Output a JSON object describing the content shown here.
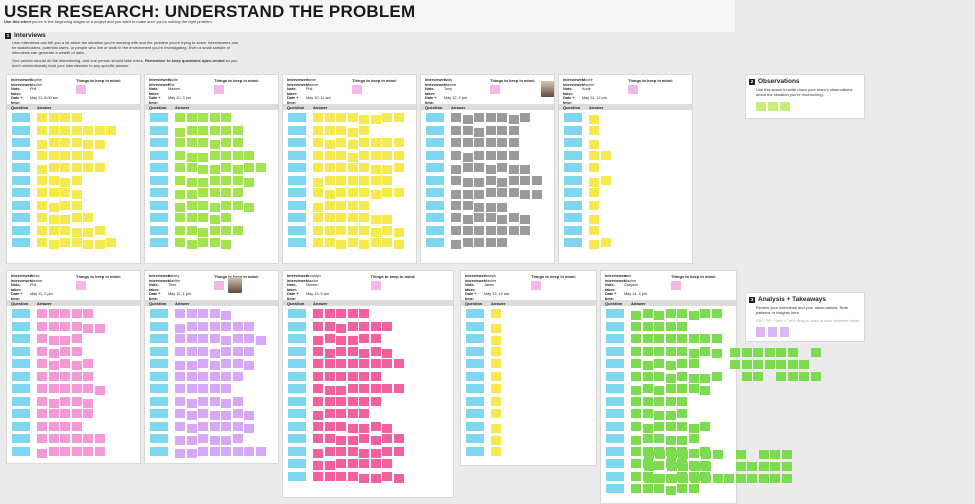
{
  "header": {
    "title": "USER RESEARCH: UNDERSTAND THE PROBLEM",
    "subtitle_bold": "Use this when",
    "subtitle_rest": " you're in the beginning stages of a project and you want to make sure you're solving the right problem."
  },
  "interviews_section": {
    "number": "1",
    "title": "Interviews",
    "para1": "User interviews can tell you a lot about the situation you're working with and the problem you're trying to solve. Interviewees can be stakeholders, potential users, or people who live or work in the environment you're investigating. Even a small sample of interviews can generate a wealth of data.",
    "para2_start": "One person should do the interviewing, and one person should take notes. ",
    "para2_bold": "Remember to keep questions open-ended",
    "para2_end": " so you don't unintentionally lead your interviewees to any specific answer."
  },
  "observations_section": {
    "number": "2",
    "title": "Observations",
    "text": "Use this space to write down your team's observations about the situation you're researching."
  },
  "analysis_section": {
    "number": "3",
    "title": "Analysis + Takeaways",
    "text": "Review your interviews and your observations. Note patterns or insights here.",
    "tip": "PRO TIP: Hold 'C' and drag to draw arrows between ideas."
  },
  "labels": {
    "interviewee": "Interviewee:",
    "interviewer": "Interviewer:",
    "note_taker": "Note-taker:",
    "date_time": "Date + time:",
    "keep_in_mind": "Things to keep in mind:",
    "question": "Question",
    "answer": "Answer"
  },
  "interviews": [
    {
      "interviewee": "Sophie",
      "interviewer": "Maxine",
      "note_taker": "Phil",
      "date": "May 11, 8:00 am",
      "color": "#f5e94f",
      "has_avatar": false
    },
    {
      "interviewee": "Sadie",
      "interviewer": "Phil",
      "note_taker": "Maxine",
      "date": "May 10, 3 pm",
      "color": "#a3e34f",
      "has_avatar": false
    },
    {
      "interviewee": "Jaime",
      "interviewer": "Maxine",
      "note_taker": "Phil",
      "date": "May 10, 11 am",
      "color": "#f5e94f",
      "has_avatar": false
    },
    {
      "interviewee": "Sally",
      "interviewer": "Maxine",
      "note_taker": "Tony",
      "date": "May 12, 4 pm",
      "color": "#9b9b9b",
      "has_avatar": true
    },
    {
      "interviewee": "Moore",
      "interviewer": "Maxine",
      "note_taker": "Kurie",
      "date": "May 11, 12 pm",
      "color": "#f5e94f",
      "has_avatar": false
    },
    {
      "interviewee": "Alexa",
      "interviewer": "Maxine",
      "note_taker": "Phil",
      "date": "May 11, 2 pm",
      "color": "#f59ad6",
      "has_avatar": false
    },
    {
      "interviewee": "Ashley",
      "interviewer": "Maxine",
      "note_taker": "Timo",
      "date": "May 12, 1 pm",
      "color": "#d6a8f5",
      "has_avatar": true
    },
    {
      "interviewee": "Brooklyn",
      "interviewer": "Maxine",
      "note_taker": "Noreen",
      "date": "May 13, 9 am",
      "color": "#f2609e",
      "has_avatar": false
    },
    {
      "interviewee": "Joseph",
      "interviewer": "Maxine",
      "note_taker": "Jamie",
      "date": "May 13, 10 am",
      "color": "#f5e94f",
      "has_avatar": false
    },
    {
      "interviewee": "user",
      "interviewer": "Maxine",
      "note_taker": "Grayson",
      "date": "May 14, 4 pm",
      "color": "#7ddb4f",
      "has_avatar": false
    }
  ],
  "colors": {
    "question_sticky": "#7fd6ef",
    "keep_note": "#f2b8e8",
    "observation_sticky": "#c7f07a",
    "analysis_sticky": "#d9b8f5",
    "analysis_green": "#7ddb4f"
  }
}
